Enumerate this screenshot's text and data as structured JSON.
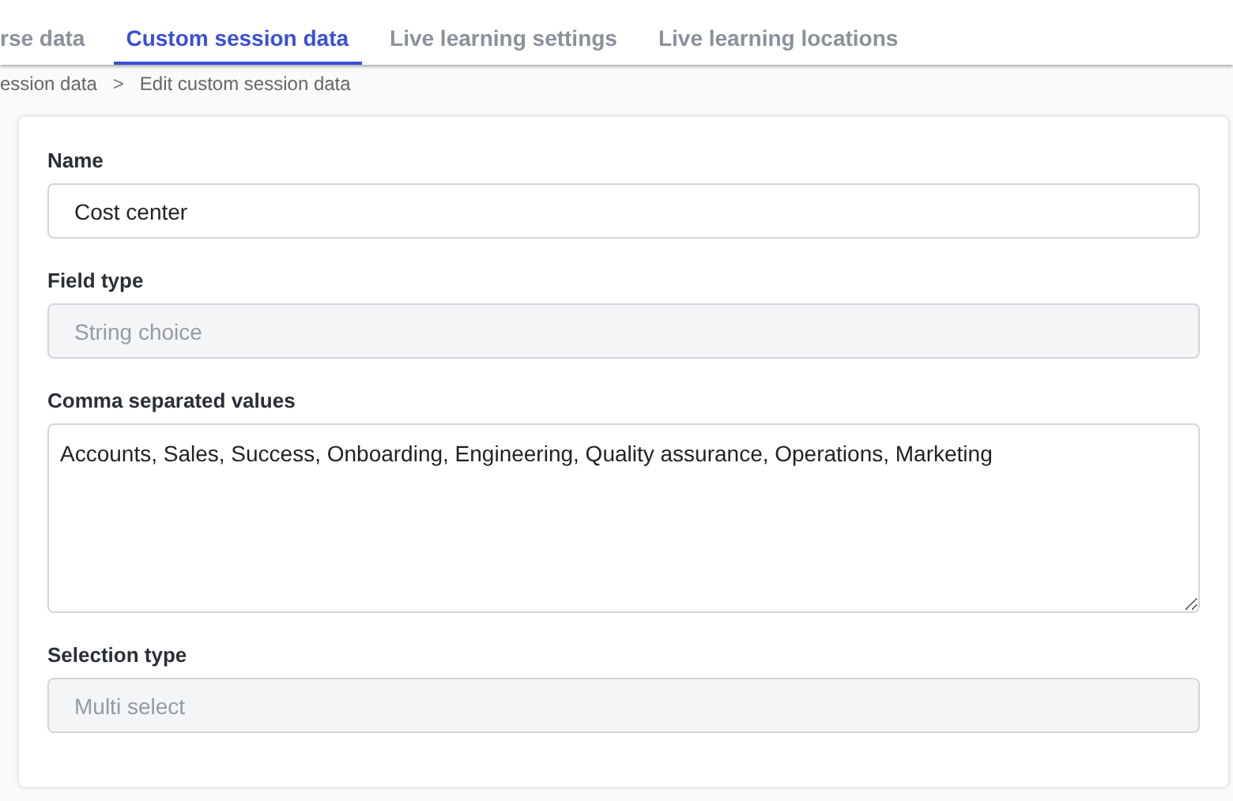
{
  "tabs": [
    {
      "label": "rse data",
      "selected": false
    },
    {
      "label": "Custom session data",
      "selected": true
    },
    {
      "label": "Live learning settings",
      "selected": false
    },
    {
      "label": "Live learning locations",
      "selected": false
    }
  ],
  "breadcrumb": [
    "ession data",
    "Edit custom session data"
  ],
  "breadcrumb_separator": ">",
  "form": {
    "fields": [
      {
        "label": "Name",
        "kind": "input",
        "value": "Cost center",
        "disabled": false
      },
      {
        "label": "Field type",
        "kind": "input",
        "value": "String choice",
        "disabled": true
      },
      {
        "label": "Comma separated values",
        "kind": "textarea",
        "value": "Accounts, Sales, Success, Onboarding, Engineering, Quality assurance, Operations, Marketing",
        "disabled": false
      },
      {
        "label": "Selection type",
        "kind": "input",
        "value": "Multi select",
        "disabled": true
      }
    ]
  }
}
